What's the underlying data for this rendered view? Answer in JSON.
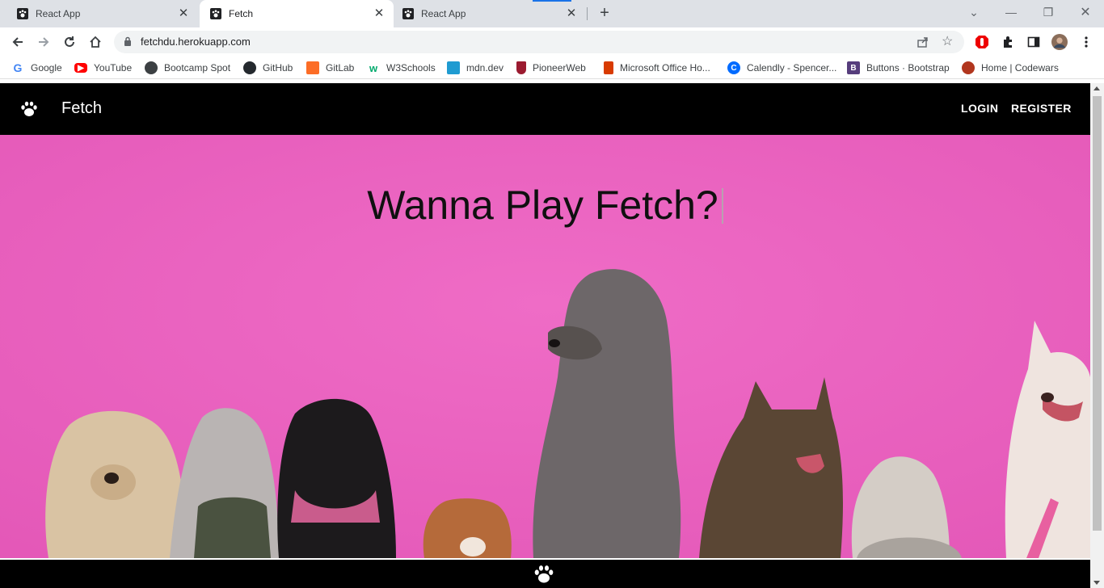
{
  "browser": {
    "tabs": [
      {
        "title": "React App",
        "active": false
      },
      {
        "title": "Fetch",
        "active": true
      },
      {
        "title": "React App",
        "active": false
      }
    ],
    "url": "fetchdu.herokuapp.com",
    "bookmarks": [
      {
        "label": "Google",
        "icon": "google-icon",
        "color": "#4285f4"
      },
      {
        "label": "YouTube",
        "icon": "youtube-icon",
        "color": "#ff0000"
      },
      {
        "label": "Bootcamp Spot",
        "icon": "globe-icon",
        "color": "#3c4043"
      },
      {
        "label": "GitHub",
        "icon": "github-icon",
        "color": "#24292e"
      },
      {
        "label": "GitLab",
        "icon": "gitlab-icon",
        "color": "#fc6d26"
      },
      {
        "label": "W3Schools",
        "icon": "w3schools-icon",
        "color": "#04aa6d"
      },
      {
        "label": "mdn.dev",
        "icon": "mdn-icon",
        "color": "#1f9bd1"
      },
      {
        "label": "PioneerWeb",
        "icon": "pioneer-icon",
        "color": "#9b1b30"
      },
      {
        "label": "Microsoft Office Ho...",
        "icon": "office-icon",
        "color": "#d83b01"
      },
      {
        "label": "Calendly - Spencer...",
        "icon": "calendly-icon",
        "color": "#006bff"
      },
      {
        "label": "Buttons · Bootstrap",
        "icon": "bootstrap-icon",
        "color": "#563d7c"
      },
      {
        "label": "Home | Codewars",
        "icon": "codewars-icon",
        "color": "#b1361e"
      }
    ]
  },
  "app": {
    "brand": "Fetch",
    "nav": {
      "login": "LOGIN",
      "register": "REGISTER"
    },
    "hero_title": "Wanna Play Fetch?",
    "colors": {
      "bar": "#000000",
      "hero_bg": "#ea5fbe"
    }
  }
}
